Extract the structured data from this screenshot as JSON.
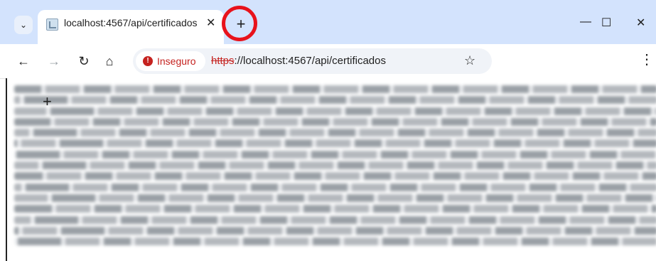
{
  "browser": {
    "tab": {
      "title": "localhost:4567/api/certificados",
      "close_glyph": "✕"
    },
    "tab_search_glyph": "⌄",
    "new_tab_glyph": "+",
    "window_controls": {
      "minimize": "—",
      "maximize": "☐",
      "close": "✕"
    },
    "nav": {
      "back": "←",
      "forward": "→",
      "reload": "↻",
      "home": "⌂"
    },
    "security_chip": {
      "icon": "error-icon",
      "label": "Inseguro"
    },
    "address": {
      "scheme": "https",
      "rest": "://localhost:4567/api/certificados"
    },
    "bookmark_glyph": "☆",
    "menu_glyph": "⋮"
  },
  "page": {
    "blurred_line_count": 15
  }
}
